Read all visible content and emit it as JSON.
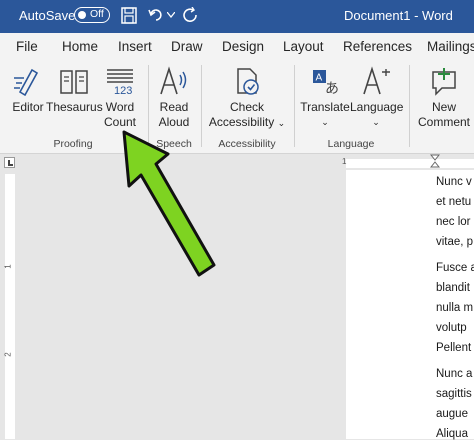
{
  "titlebar": {
    "autosave_label": "AutoSave",
    "autosave_state": "Off",
    "document_title": "Document1 - Word",
    "icons": [
      "save-icon",
      "undo-icon",
      "dropdown-icon",
      "redo-icon"
    ]
  },
  "tabs": [
    "File",
    "Home",
    "Insert",
    "Draw",
    "Design",
    "Layout",
    "References",
    "Mailings"
  ],
  "ribbon": {
    "proofing": {
      "group_label": "Proofing",
      "editor": "Editor",
      "thesaurus": "Thesaurus",
      "word_count_line1": "Word",
      "word_count_line2": "Count",
      "word_count_icon_number": "123"
    },
    "speech": {
      "group_label": "Speech",
      "read_aloud_line1": "Read",
      "read_aloud_line2": "Aloud"
    },
    "accessibility": {
      "group_label": "Accessibility",
      "check_line1": "Check",
      "check_line2": "Accessibility"
    },
    "language": {
      "group_label": "Language",
      "translate": "Translate",
      "language": "Language"
    },
    "comments": {
      "new_line1": "New",
      "new_line2": "Comment"
    }
  },
  "ruler": {
    "h_mark": "1",
    "v_marks": [
      "1",
      "2"
    ]
  },
  "document": {
    "lines": [
      "Nunc v",
      "et netu",
      "nec lor",
      "vitae, p",
      "Fusce a",
      "blandit",
      "nulla m",
      "volutp",
      "Pellent",
      "Nunc a",
      "sagittis",
      "augue",
      "Aliqua"
    ]
  },
  "colors": {
    "titlebar": "#2b579a",
    "ribbon": "#f3f3f3",
    "accent_icon": "#2b579a",
    "arrow": "#7ed321"
  }
}
